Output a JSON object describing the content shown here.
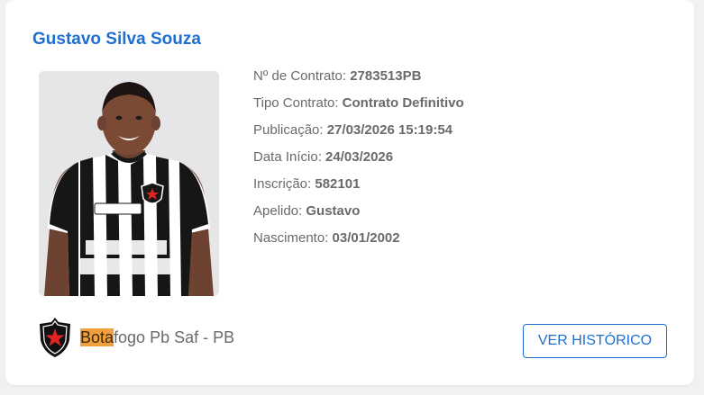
{
  "player": {
    "name": "Gustavo Silva Souza",
    "photo_alt": "player-photo"
  },
  "details": [
    {
      "label": "Nº de Contrato: ",
      "value": "2783513PB"
    },
    {
      "label": "Tipo Contrato: ",
      "value": "Contrato Definitivo"
    },
    {
      "label": "Publicação: ",
      "value": "27/03/2026 15:19:54"
    },
    {
      "label": "Data Início: ",
      "value": "24/03/2026"
    },
    {
      "label": "Inscrição: ",
      "value": "582101"
    },
    {
      "label": "Apelido: ",
      "value": "Gustavo"
    },
    {
      "label": "Nascimento: ",
      "value": "03/01/2002"
    }
  ],
  "club": {
    "name_highlight": "Bota",
    "name_rest": "fogo Pb Saf - PB",
    "crest_icon": "club-crest-icon"
  },
  "actions": {
    "history_label": "VER HISTÓRICO"
  },
  "colors": {
    "accent": "#1f6fd1",
    "highlight": "#f2a03d",
    "text": "#6a6a6a"
  }
}
